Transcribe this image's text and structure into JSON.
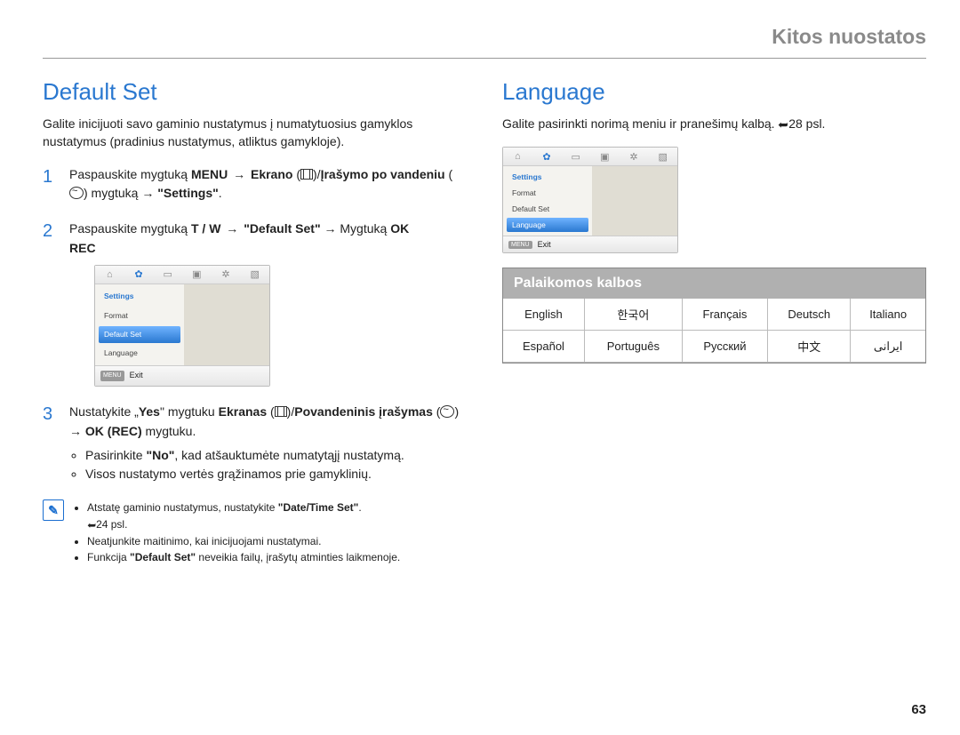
{
  "header": {
    "title": "Kitos nuostatos"
  },
  "page_number": "63",
  "left": {
    "title": "Default Set",
    "intro": "Galite inicijuoti savo gaminio nustatymus į numatytuosius gamyklos nustatymus (pradinius nustatymus, atliktus gamykloje).",
    "step1": {
      "t1": "Paspauskite mygtuką ",
      "bold1": "MENU",
      "arrow": " → ",
      "bold2": "Ekrano",
      "sep": " (",
      "close": ")/",
      "bold3": "Įrašymo po vandeniu",
      "paren2": " (",
      "close2": ") mygtuką → ",
      "bold4": "\"Settings\"",
      "end": "."
    },
    "step2": {
      "t1": "Paspauskite mygtuką ",
      "bold1": "T / W",
      "arrow": " → ",
      "bold2": "\"Default Set\"",
      "arrow2": " → Mygtuką ",
      "bold3": "OK",
      "paren": " ",
      "bold4": "REC",
      "end": ""
    },
    "device": {
      "settings": "Settings",
      "format": "Format",
      "default_set": "Default Set",
      "language": "Language",
      "exit": "Exit",
      "menu": "MENU"
    },
    "step3": {
      "t1": "Nustatykite „",
      "bold1": "Yes",
      "t2": "\" mygtuku ",
      "bold2": "Ekranas",
      "paren": " (",
      "close": ")/",
      "bold3": "Povandeninis įrašymas",
      "paren2": " (",
      "close2": ") → ",
      "bold4": "OK (REC)",
      "t3": " mygtuku.",
      "bullet1_a": "Pasirinkite ",
      "bullet1_b": "\"No\"",
      "bullet1_c": ", kad atšauktumėte numatytąjį nustatymą.",
      "bullet2": "Visos nustatymo vertės grąžinamos prie gamyklinių."
    },
    "notes": {
      "n1_a": "Atstatę gaminio nustatymus, nustatykite ",
      "n1_b": "\"Date/Time Set\"",
      "n1_c": ". ",
      "n1_ref": "24 psl.",
      "n2": "Neatjunkite maitinimo, kai inicijuojami nustatymai.",
      "n3_a": "Funkcija ",
      "n3_b": "\"Default Set\"",
      "n3_c": " neveikia failų, įrašytų atminties laikmenoje."
    }
  },
  "right": {
    "title": "Language",
    "intro_a": "Galite pasirinkti norimą meniu ir pranešimų kalbą. ",
    "intro_ref": "28 psl.",
    "device": {
      "settings": "Settings",
      "format": "Format",
      "default_set": "Default Set",
      "language": "Language",
      "exit": "Exit",
      "menu": "MENU"
    },
    "lang_title": "Palaikomos kalbos",
    "languages": [
      [
        "English",
        "한국어",
        "Français",
        "Deutsch",
        "Italiano"
      ],
      [
        "Español",
        "Português",
        "Русский",
        "中文",
        "ایرانی"
      ]
    ]
  }
}
